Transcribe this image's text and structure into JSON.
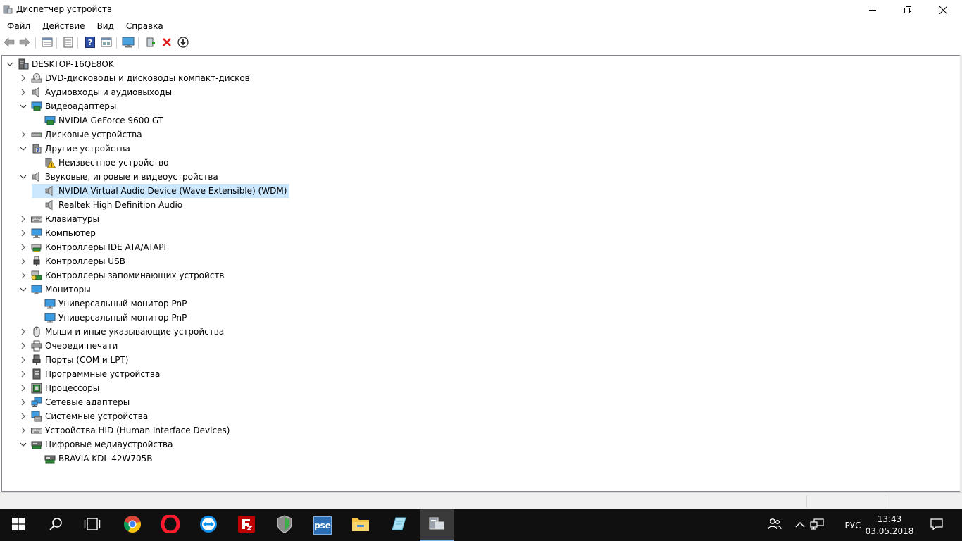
{
  "window": {
    "title": "Диспетчер устройств",
    "minimize_icon": "minimize-icon",
    "maximize_icon": "maximize-icon",
    "close_icon": "close-icon"
  },
  "menu": [
    "Файл",
    "Действие",
    "Вид",
    "Справка"
  ],
  "toolbar_icons": [
    "back-arrow-icon",
    "forward-arrow-icon",
    "properties-icon",
    "list-icon",
    "help-icon",
    "view-icon",
    "monitor-icon",
    "add-driver-icon",
    "remove-device-icon",
    "update-driver-icon"
  ],
  "tree": {
    "root": "DESKTOP-16QE8OK",
    "nodes": [
      {
        "label": "DVD-дисководы и дисководы компакт-дисков",
        "icon": "dvd-drive-icon",
        "expanded": false,
        "children": []
      },
      {
        "label": "Аудиовходы и аудиовыходы",
        "icon": "speaker-icon",
        "expanded": false,
        "children": []
      },
      {
        "label": "Видеоадаптеры",
        "icon": "display-adapter-icon",
        "expanded": true,
        "children": [
          {
            "label": "NVIDIA GeForce 9600 GT",
            "icon": "display-adapter-icon"
          }
        ]
      },
      {
        "label": "Дисковые устройства",
        "icon": "disk-drive-icon",
        "expanded": false,
        "children": []
      },
      {
        "label": "Другие устройства",
        "icon": "other-device-icon",
        "expanded": true,
        "children": [
          {
            "label": "Неизвестное устройство",
            "icon": "warning-device-icon"
          }
        ]
      },
      {
        "label": "Звуковые, игровые и видеоустройства",
        "icon": "speaker-icon",
        "expanded": true,
        "children": [
          {
            "label": "NVIDIA Virtual Audio Device (Wave Extensible) (WDM)",
            "icon": "speaker-icon",
            "selected": true
          },
          {
            "label": "Realtek High Definition Audio",
            "icon": "speaker-icon"
          }
        ]
      },
      {
        "label": "Клавиатуры",
        "icon": "keyboard-icon",
        "expanded": false,
        "children": []
      },
      {
        "label": "Компьютер",
        "icon": "computer-icon",
        "expanded": false,
        "children": []
      },
      {
        "label": "Контроллеры IDE ATA/ATAPI",
        "icon": "ide-controller-icon",
        "expanded": false,
        "children": []
      },
      {
        "label": "Контроллеры USB",
        "icon": "usb-icon",
        "expanded": false,
        "children": []
      },
      {
        "label": "Контроллеры запоминающих устройств",
        "icon": "storage-controller-icon",
        "expanded": false,
        "children": []
      },
      {
        "label": "Мониторы",
        "icon": "monitor-icon",
        "expanded": true,
        "children": [
          {
            "label": "Универсальный монитор PnP",
            "icon": "monitor-icon"
          },
          {
            "label": "Универсальный монитор PnP",
            "icon": "monitor-icon"
          }
        ]
      },
      {
        "label": "Мыши и иные указывающие устройства",
        "icon": "mouse-icon",
        "expanded": false,
        "children": []
      },
      {
        "label": "Очереди печати",
        "icon": "printer-icon",
        "expanded": false,
        "children": []
      },
      {
        "label": "Порты (COM и LPT)",
        "icon": "port-icon",
        "expanded": false,
        "children": []
      },
      {
        "label": "Программные устройства",
        "icon": "software-device-icon",
        "expanded": false,
        "children": []
      },
      {
        "label": "Процессоры",
        "icon": "processor-icon",
        "expanded": false,
        "children": []
      },
      {
        "label": "Сетевые адаптеры",
        "icon": "network-adapter-icon",
        "expanded": false,
        "children": []
      },
      {
        "label": "Системные устройства",
        "icon": "system-device-icon",
        "expanded": false,
        "children": []
      },
      {
        "label": "Устройства HID (Human Interface Devices)",
        "icon": "hid-icon",
        "expanded": false,
        "children": []
      },
      {
        "label": "Цифровые медиаустройства",
        "icon": "media-device-icon",
        "expanded": true,
        "children": [
          {
            "label": "BRAVIA KDL-42W705B",
            "icon": "media-device-icon"
          }
        ]
      }
    ]
  },
  "taskbar": {
    "apps": [
      "start-icon",
      "search-icon",
      "task-view-icon",
      "chrome-icon",
      "opera-icon",
      "teamviewer-icon",
      "filezilla-icon",
      "vpn-shield-icon",
      "pse-icon",
      "file-explorer-icon",
      "notepad-icon",
      "device-manager-icon"
    ],
    "pse_label": "pse",
    "tray_icons": [
      "people-icon",
      "chevron-up-icon",
      "network-icon"
    ],
    "language": "РУС",
    "time": "13:43",
    "date": "03.05.2018",
    "notification_icon": "notification-icon"
  },
  "colors": {
    "selection": "#cce8ff",
    "taskbar": "#101010",
    "accent": "#0078d7"
  }
}
